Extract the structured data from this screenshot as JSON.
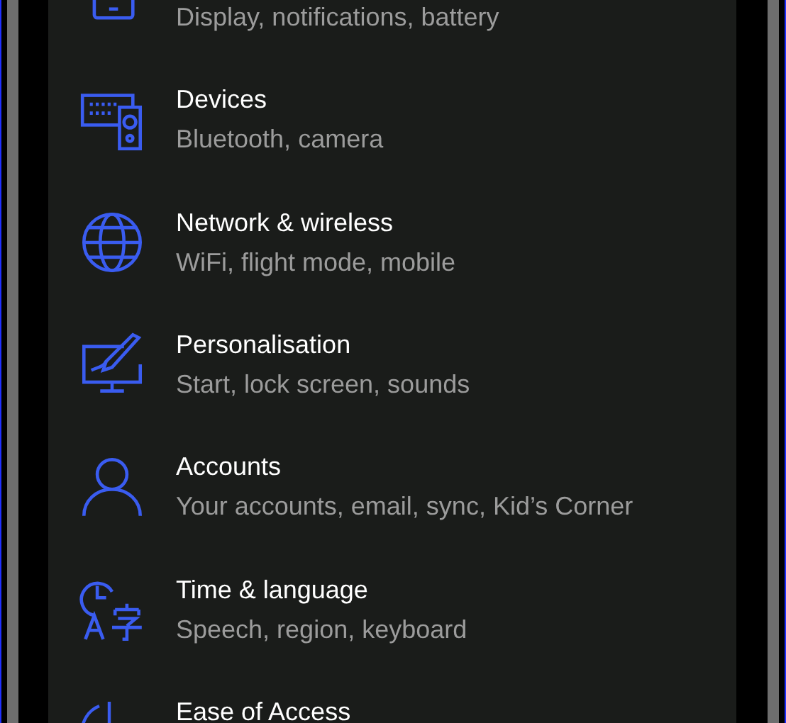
{
  "settings_items": [
    {
      "subtitle": "Display, notifications, battery"
    },
    {
      "title": "Devices",
      "subtitle": "Bluetooth, camera"
    },
    {
      "title": "Network & wireless",
      "subtitle": "WiFi, flight mode, mobile"
    },
    {
      "title": "Personalisation",
      "subtitle": "Start, lock screen, sounds"
    },
    {
      "title": "Accounts",
      "subtitle": "Your accounts, email, sync, Kid’s Corner"
    },
    {
      "title": "Time & language",
      "subtitle": "Speech, region, keyboard"
    },
    {
      "title": "Ease of Access"
    }
  ]
}
